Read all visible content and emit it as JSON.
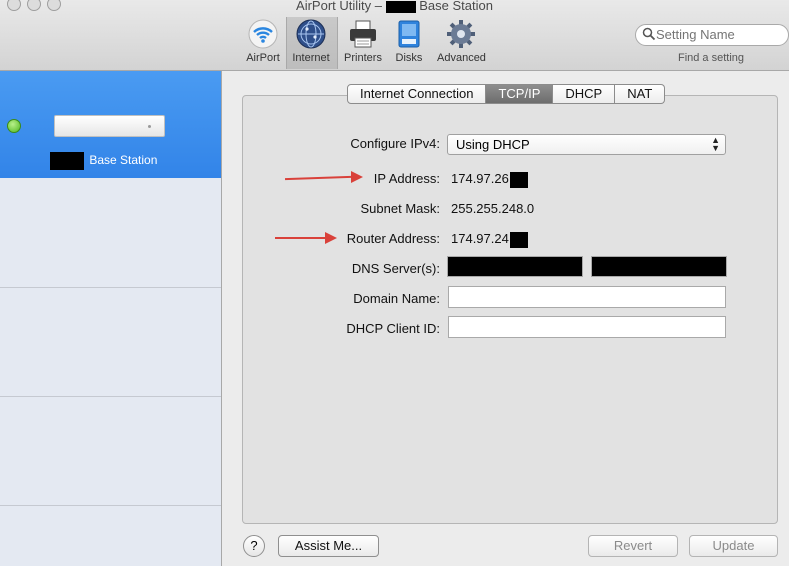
{
  "window": {
    "title_prefix": "AirPort Utility –",
    "title_suffix": "Base Station"
  },
  "toolbar": {
    "buttons": [
      {
        "label": "AirPort",
        "icon": "airport-wifi-icon"
      },
      {
        "label": "Internet",
        "icon": "internet-globe-icon"
      },
      {
        "label": "Printers",
        "icon": "printer-icon"
      },
      {
        "label": "Disks",
        "icon": "disk-icon"
      },
      {
        "label": "Advanced",
        "icon": "gear-icon"
      }
    ],
    "selected": "Internet",
    "search": {
      "placeholder": "Setting Name",
      "caption": "Find a setting"
    }
  },
  "sidebar": {
    "device_name": "Base Station",
    "status_color": "#4fb61e"
  },
  "tabs": [
    {
      "label": "Internet Connection"
    },
    {
      "label": "TCP/IP"
    },
    {
      "label": "DHCP"
    },
    {
      "label": "NAT"
    }
  ],
  "selected_tab": "TCP/IP",
  "form": {
    "configure_ipv4": {
      "label": "Configure IPv4:",
      "value": "Using DHCP"
    },
    "ip_address": {
      "label": "IP Address:",
      "value": "174.97.26"
    },
    "subnet_mask": {
      "label": "Subnet Mask:",
      "value": "255.255.248.0"
    },
    "router_address": {
      "label": "Router Address:",
      "value": "174.97.24"
    },
    "dns_servers": {
      "label": "DNS Server(s):"
    },
    "domain_name": {
      "label": "Domain Name:",
      "value": ""
    },
    "dhcp_client_id": {
      "label": "DHCP Client ID:",
      "value": ""
    }
  },
  "annotation_color": "#d9413a",
  "footer": {
    "help": "?",
    "assist": "Assist Me...",
    "revert": "Revert",
    "update": "Update"
  }
}
